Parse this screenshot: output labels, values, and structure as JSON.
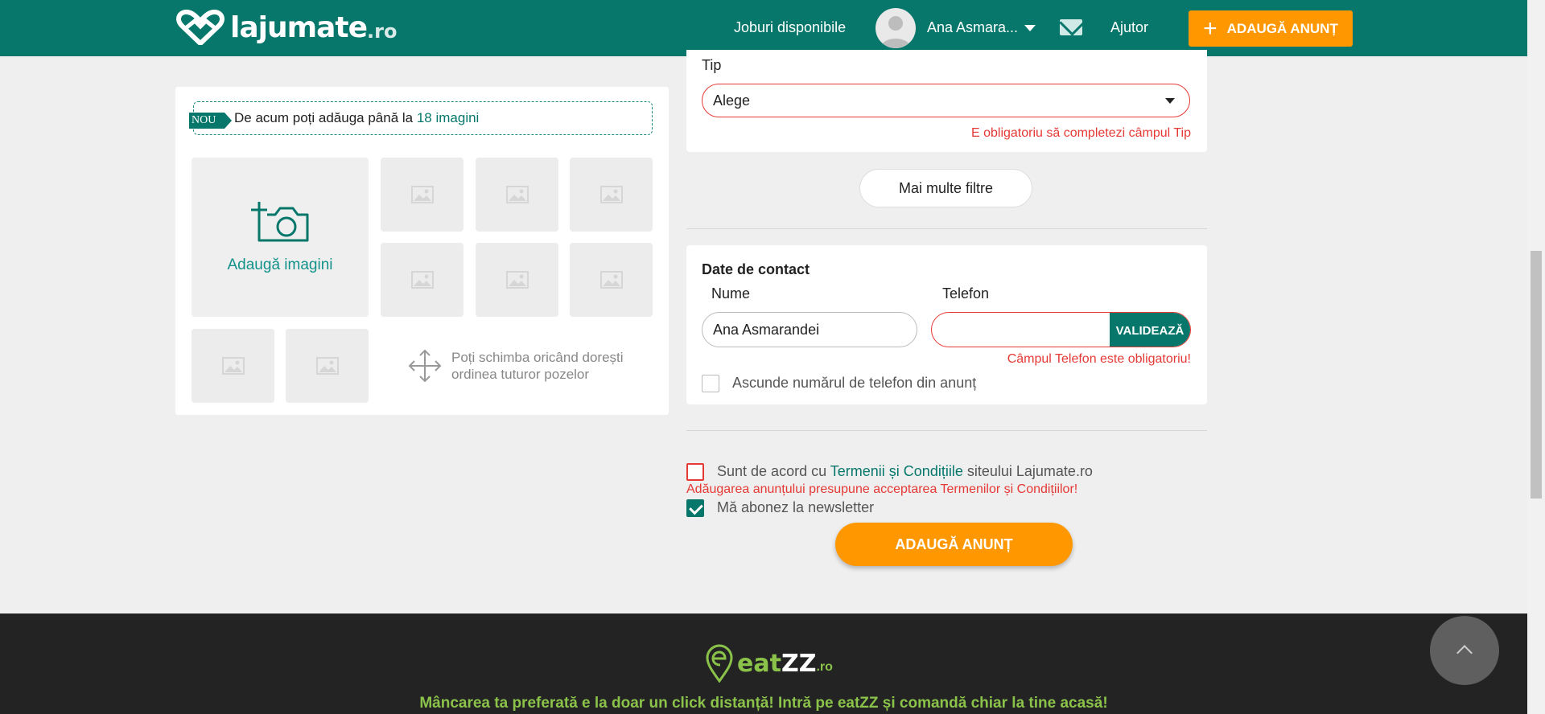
{
  "header": {
    "logo_text": "lajumate",
    "logo_tld": ".ro",
    "jobs_link": "Joburi disponibile",
    "user_name": "Ana Asmara...",
    "help_link": "Ajutor",
    "add_ad_button": "ADAUGĂ ANUNȚ",
    "brand_color": "#06776a",
    "accent_color": "#ff9800"
  },
  "images": {
    "nou_badge": "NOU",
    "nou_text": "De acum poți adăuga până la",
    "nou_highlight": "18 imagini",
    "add_images_label": "Adaugă imagini",
    "reorder_line1": "Poți schimba oricând dorești",
    "reorder_line2": "ordinea tuturor pozelor",
    "slot_icon": "image-placeholder-icon"
  },
  "type_section": {
    "label": "Tip",
    "selected": "Alege",
    "error": "E obligatoriu să completezi câmpul Tip"
  },
  "more_filters_button": "Mai multe filtre",
  "contact": {
    "title": "Date de contact",
    "name_label": "Nume",
    "name_value": "Ana Asmarandei",
    "phone_label": "Telefon",
    "phone_value": "",
    "validate_button": "VALIDEAZĂ",
    "phone_error": "Câmpul Telefon este obligatoriu!",
    "hide_phone_label": "Ascunde numărul de telefon din anunț",
    "hide_phone_checked": false
  },
  "terms": {
    "prefix": "Sunt de acord cu",
    "link": "Termenii și Condițiile",
    "suffix": "siteului Lajumate.ro",
    "checked": false,
    "error": "Adăugarea anunțului presupune acceptarea Termenilor și Condițiilor!"
  },
  "newsletter": {
    "label": "Mă abonez la newsletter",
    "checked": true
  },
  "submit_button": "ADAUGĂ ANUNȚ",
  "footer": {
    "brand_e": "eat",
    "brand_zz": "ZZ",
    "brand_tld": ".ro",
    "promo": "Mâncarea ta preferată e la doar un click distanță! Intră pe eatZZ și comandă chiar la tine acasă!",
    "brand_color": "#8bc34a"
  },
  "back_to_top_icon": "chevron-up-icon"
}
